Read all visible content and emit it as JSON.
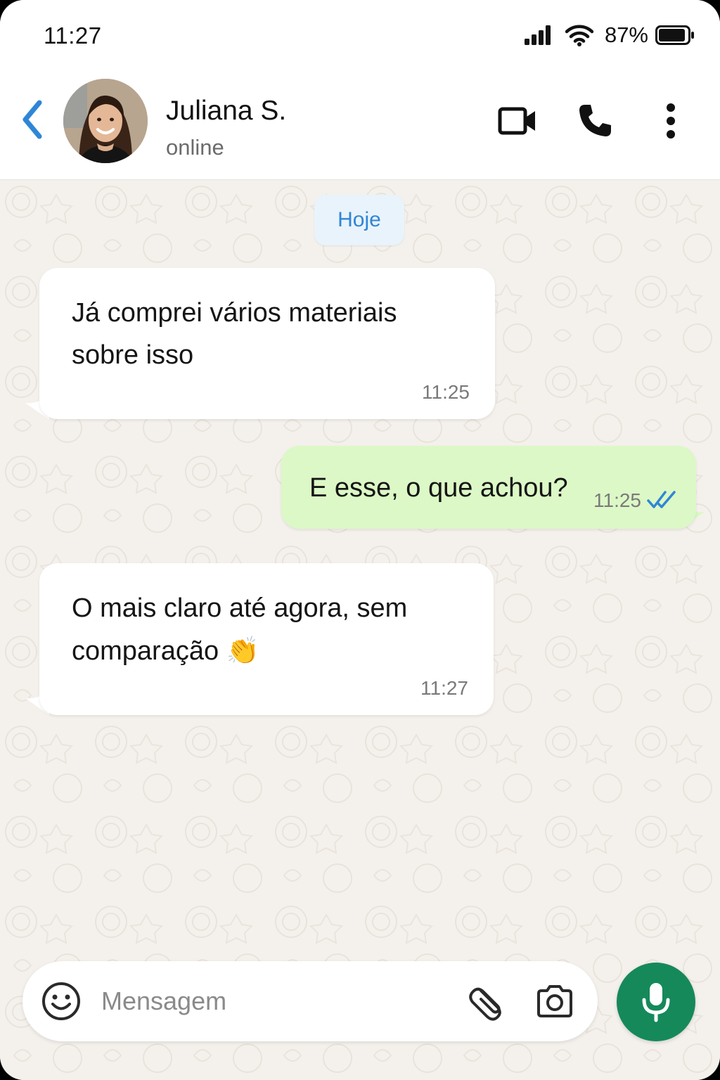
{
  "status_bar": {
    "time": "11:27",
    "battery_percent": "87%",
    "signal_icon": "cellular-signal-icon",
    "wifi_icon": "wifi-icon",
    "battery_icon": "battery-icon"
  },
  "header": {
    "contact_name": "Juliana S.",
    "contact_status": "online",
    "back_icon": "chevron-left-icon",
    "actions": [
      "video-call-icon",
      "phone-icon",
      "more-vertical-icon"
    ]
  },
  "chat": {
    "date_label": "Hoje",
    "messages": [
      {
        "direction": "incoming",
        "text_line1": "Já comprei vários materiais",
        "text_line2": "sobre isso",
        "time": "11:25"
      },
      {
        "direction": "outgoing",
        "text": "E esse, o que achou?",
        "time": "11:25",
        "status": "read"
      },
      {
        "direction": "incoming",
        "text_line1": "O mais claro até agora, sem",
        "text_line2": "comparação",
        "emoji": "👏",
        "time": "11:27"
      }
    ]
  },
  "composer": {
    "placeholder": "Mensagem",
    "value": "",
    "emoji_icon": "smiley-icon",
    "attach_icon": "paperclip-icon",
    "camera_icon": "camera-icon",
    "mic_icon": "microphone-icon"
  },
  "colors": {
    "accent_blue": "#2f86d6",
    "outgoing_bubble": "#dcf8c6",
    "mic_green": "#15895a",
    "chat_background": "#f4f1ec"
  }
}
